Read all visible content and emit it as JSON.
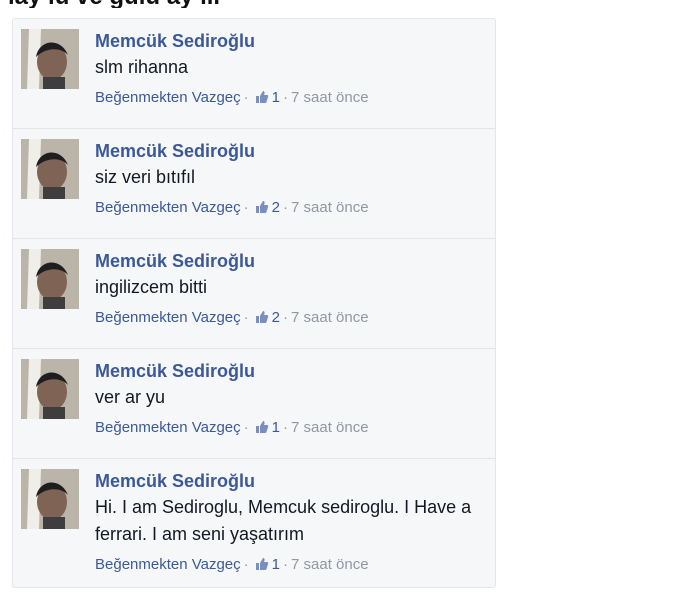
{
  "page": {
    "top_cut_text": "lay lu ve gulu    ay  iil    "
  },
  "comments": [
    {
      "author": "Memcük Sediroğlu",
      "text": "slm rihanna",
      "unlike_label": "Beğenmekten Vazgeç",
      "likes": "1",
      "time": "7 saat önce"
    },
    {
      "author": "Memcük Sediroğlu",
      "text": "siz veri bıtıfıl",
      "unlike_label": "Beğenmekten Vazgeç",
      "likes": "2",
      "time": "7 saat önce"
    },
    {
      "author": "Memcük Sediroğlu",
      "text": "ingilizcem bitti",
      "unlike_label": "Beğenmekten Vazgeç",
      "likes": "2",
      "time": "7 saat önce"
    },
    {
      "author": "Memcük Sediroğlu",
      "text": "ver ar yu",
      "unlike_label": "Beğenmekten Vazgeç",
      "likes": "1",
      "time": "7 saat önce"
    },
    {
      "author": "Memcük Sediroğlu",
      "text": "Hi. I am Sediroglu, Memcuk sediroglu. I Have a ferrari. I am seni yaşatırım",
      "unlike_label": "Beğenmekten Vazgeç",
      "likes": "1",
      "time": "7 saat önce"
    }
  ],
  "icons": {
    "avatar": "profile-photo",
    "like": "thumbs-up-icon"
  },
  "colors": {
    "author": "#3b5998",
    "meta": "#9197a3",
    "panel_bg": "#f6f7f9"
  }
}
